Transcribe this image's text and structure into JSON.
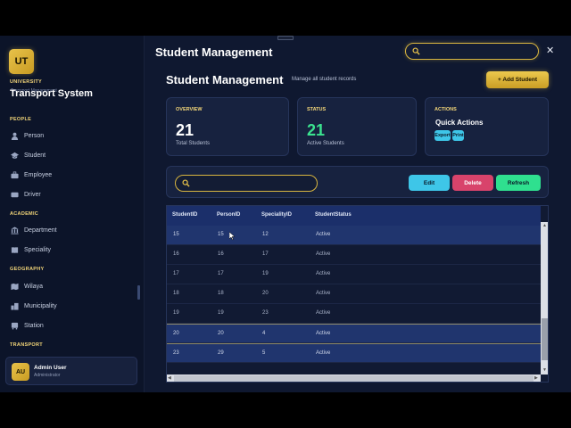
{
  "sidebar": {
    "logo": "UT",
    "university": "UNIVERSITY",
    "subtitle": "Transport Management",
    "title": "Transport System",
    "sections": {
      "people": "PEOPLE",
      "academic": "ACADEMIC",
      "geography": "GEOGRAPHY",
      "transport": "TRANSPORT"
    },
    "items": {
      "person": "Person",
      "student": "Student",
      "employee": "Employee",
      "driver": "Driver",
      "department": "Department",
      "speciality": "Speciality",
      "wilaya": "Wilaya",
      "municipality": "Municipality",
      "station": "Station"
    },
    "user": {
      "initials": "AU",
      "name": "Admin User",
      "role": "Administrator"
    }
  },
  "header": {
    "title": "Student Management",
    "close": "✕"
  },
  "page": {
    "title": "Student Management",
    "subtitle": "Manage all student records",
    "add_button": "+ Add Student"
  },
  "cards": {
    "overview": {
      "label": "OVERVIEW",
      "value": "21",
      "caption": "Total Students"
    },
    "status": {
      "label": "STATUS",
      "value": "21",
      "caption": "Active Students"
    },
    "actions": {
      "label": "ACTIONS",
      "title": "Quick Actions",
      "export": "Export",
      "print": "Print"
    }
  },
  "toolbar": {
    "edit": "Edit",
    "delete": "Delete",
    "refresh": "Refresh"
  },
  "table": {
    "columns": [
      "StudentID",
      "PersonID",
      "SpecialityID",
      "StudentStatus"
    ],
    "rows": [
      [
        "15",
        "15",
        "12",
        "Active"
      ],
      [
        "16",
        "16",
        "17",
        "Active"
      ],
      [
        "17",
        "17",
        "19",
        "Active"
      ],
      [
        "18",
        "18",
        "20",
        "Active"
      ],
      [
        "19",
        "19",
        "23",
        "Active"
      ],
      [
        "20",
        "20",
        "4",
        "Active"
      ],
      [
        "23",
        "29",
        "5",
        "Active"
      ]
    ]
  },
  "colors": {
    "accent_gold": "#e8c24a",
    "edit": "#3ec6e8",
    "delete": "#d8436b",
    "refresh": "#2fe08f",
    "active_green": "#3be38f"
  }
}
